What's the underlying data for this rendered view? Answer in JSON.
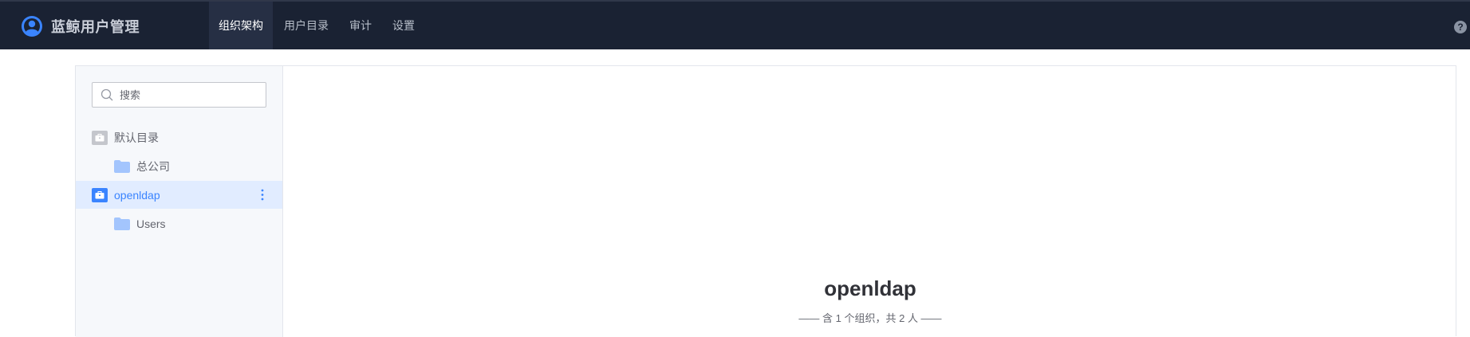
{
  "app": {
    "title": "蓝鲸用户管理"
  },
  "nav": {
    "items": [
      {
        "label": "组织架构",
        "active": true
      },
      {
        "label": "用户目录",
        "active": false
      },
      {
        "label": "审计",
        "active": false
      },
      {
        "label": "设置",
        "active": false
      }
    ],
    "help_label": "?"
  },
  "sidebar": {
    "search_placeholder": "搜索",
    "tree": [
      {
        "label": "默认目录",
        "type": "directory",
        "selected": false
      },
      {
        "label": "总公司",
        "type": "folder",
        "selected": false
      },
      {
        "label": "openldap",
        "type": "directory",
        "selected": true
      },
      {
        "label": "Users",
        "type": "folder",
        "selected": false
      }
    ]
  },
  "main": {
    "org_title": "openldap",
    "org_summary": "—— 含 1 个组织，共 2 人 ——"
  },
  "colors": {
    "topbar": "#1a2233",
    "accent": "#3a84ff",
    "selected_bg": "#e1ecff",
    "folder": "#a3c5fd",
    "directory_default": "#c4c6cc"
  }
}
